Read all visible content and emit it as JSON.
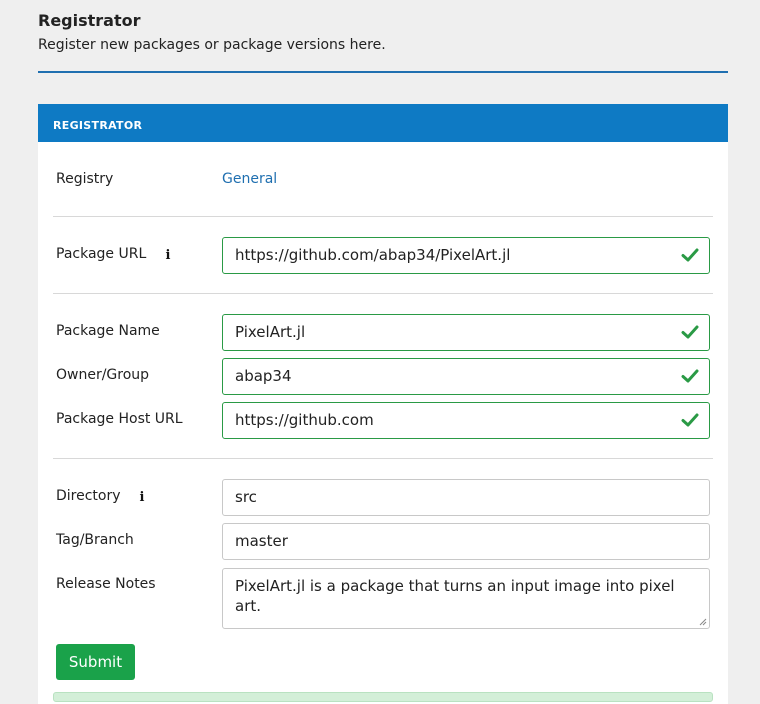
{
  "header": {
    "title": "Registrator",
    "subtitle": "Register new packages or package versions here."
  },
  "panel": {
    "title": "REGISTRATOR",
    "registry": {
      "label": "Registry",
      "value": "General"
    },
    "package_url": {
      "label": "Package URL",
      "value": "https://github.com/abap34/PixelArt.jl",
      "valid": true
    },
    "package_name": {
      "label": "Package Name",
      "value": "PixelArt.jl",
      "valid": true
    },
    "owner_group": {
      "label": "Owner/Group",
      "value": "abap34",
      "valid": true
    },
    "host_url": {
      "label": "Package Host URL",
      "value": "https://github.com",
      "valid": true
    },
    "directory": {
      "label": "Directory",
      "value": "src"
    },
    "tag_branch": {
      "label": "Tag/Branch",
      "value": "master"
    },
    "release_notes": {
      "label": "Release Notes",
      "value": "PixelArt.jl is a package that turns an input image into pixel art."
    },
    "submit_label": "Submit"
  },
  "colors": {
    "accent": "#0e7ac4",
    "valid": "#2a9a45",
    "submit": "#1aa24a"
  },
  "icons": {
    "info": "info-icon",
    "valid": "check-icon"
  }
}
